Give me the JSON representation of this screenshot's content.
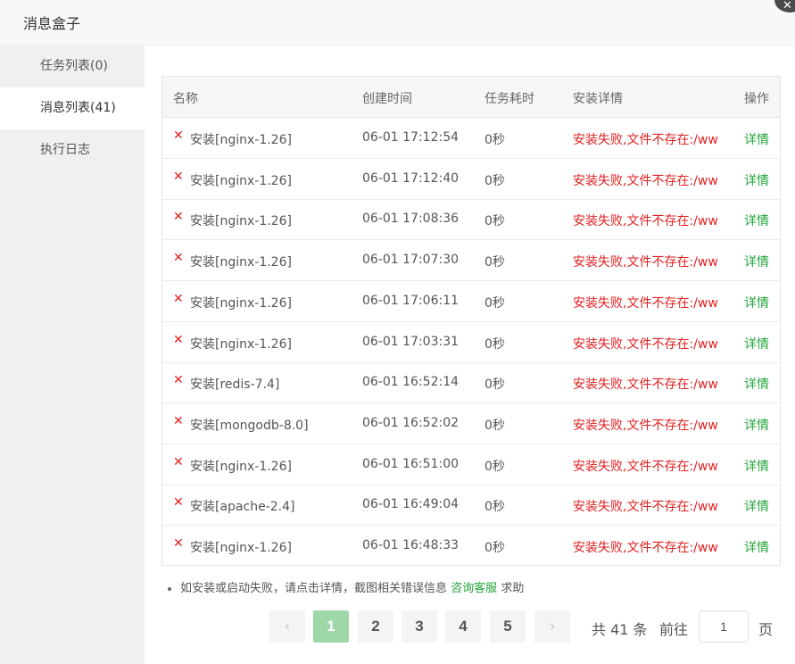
{
  "dialog": {
    "title": "消息盒子",
    "close_icon": "close-icon"
  },
  "sidebar": {
    "items": [
      {
        "label": "任务列表(0)",
        "active": false
      },
      {
        "label": "消息列表(41)",
        "active": true
      },
      {
        "label": "执行日志",
        "active": false
      }
    ]
  },
  "table": {
    "headers": [
      "名称",
      "创建时间",
      "任务耗时",
      "安装详情",
      "操作"
    ],
    "status_icon": "cross-icon",
    "rows": [
      {
        "name": "安装[nginx-1.26]",
        "time": "06-01 17:12:54",
        "duration": "0秒",
        "detail": "安装失败,文件不存在:/ww",
        "action": "详情"
      },
      {
        "name": "安装[nginx-1.26]",
        "time": "06-01 17:12:40",
        "duration": "0秒",
        "detail": "安装失败,文件不存在:/ww",
        "action": "详情"
      },
      {
        "name": "安装[nginx-1.26]",
        "time": "06-01 17:08:36",
        "duration": "0秒",
        "detail": "安装失败,文件不存在:/ww",
        "action": "详情"
      },
      {
        "name": "安装[nginx-1.26]",
        "time": "06-01 17:07:30",
        "duration": "0秒",
        "detail": "安装失败,文件不存在:/ww",
        "action": "详情"
      },
      {
        "name": "安装[nginx-1.26]",
        "time": "06-01 17:06:11",
        "duration": "0秒",
        "detail": "安装失败,文件不存在:/ww",
        "action": "详情"
      },
      {
        "name": "安装[nginx-1.26]",
        "time": "06-01 17:03:31",
        "duration": "0秒",
        "detail": "安装失败,文件不存在:/ww",
        "action": "详情"
      },
      {
        "name": "安装[redis-7.4]",
        "time": "06-01 16:52:14",
        "duration": "0秒",
        "detail": "安装失败,文件不存在:/ww",
        "action": "详情"
      },
      {
        "name": "安装[mongodb-8.0]",
        "time": "06-01 16:52:02",
        "duration": "0秒",
        "detail": "安装失败,文件不存在:/ww",
        "action": "详情"
      },
      {
        "name": "安装[nginx-1.26]",
        "time": "06-01 16:51:00",
        "duration": "0秒",
        "detail": "安装失败,文件不存在:/ww",
        "action": "详情"
      },
      {
        "name": "安装[apache-2.4]",
        "time": "06-01 16:49:04",
        "duration": "0秒",
        "detail": "安装失败,文件不存在:/ww",
        "action": "详情"
      },
      {
        "name": "安装[nginx-1.26]",
        "time": "06-01 16:48:33",
        "duration": "0秒",
        "detail": "安装失败,文件不存在:/ww",
        "action": "详情"
      }
    ]
  },
  "tip": {
    "text": "如安装或启动失败，请点击详情，截图相关错误信息",
    "link": "咨询客服",
    "suffix": "求助"
  },
  "pagination": {
    "prev_icon": "chevron-left-icon",
    "next_icon": "chevron-right-icon",
    "pages": [
      "1",
      "2",
      "3",
      "4",
      "5"
    ],
    "current": "1",
    "total_text": "共 41 条",
    "goto_label": "前往",
    "goto_value": "1",
    "page_unit": "页"
  },
  "colors": {
    "accent": "#20a53a",
    "error": "#e02020",
    "active_page": "#9ed8a8",
    "sidebar_bg": "#f0f0f0"
  }
}
